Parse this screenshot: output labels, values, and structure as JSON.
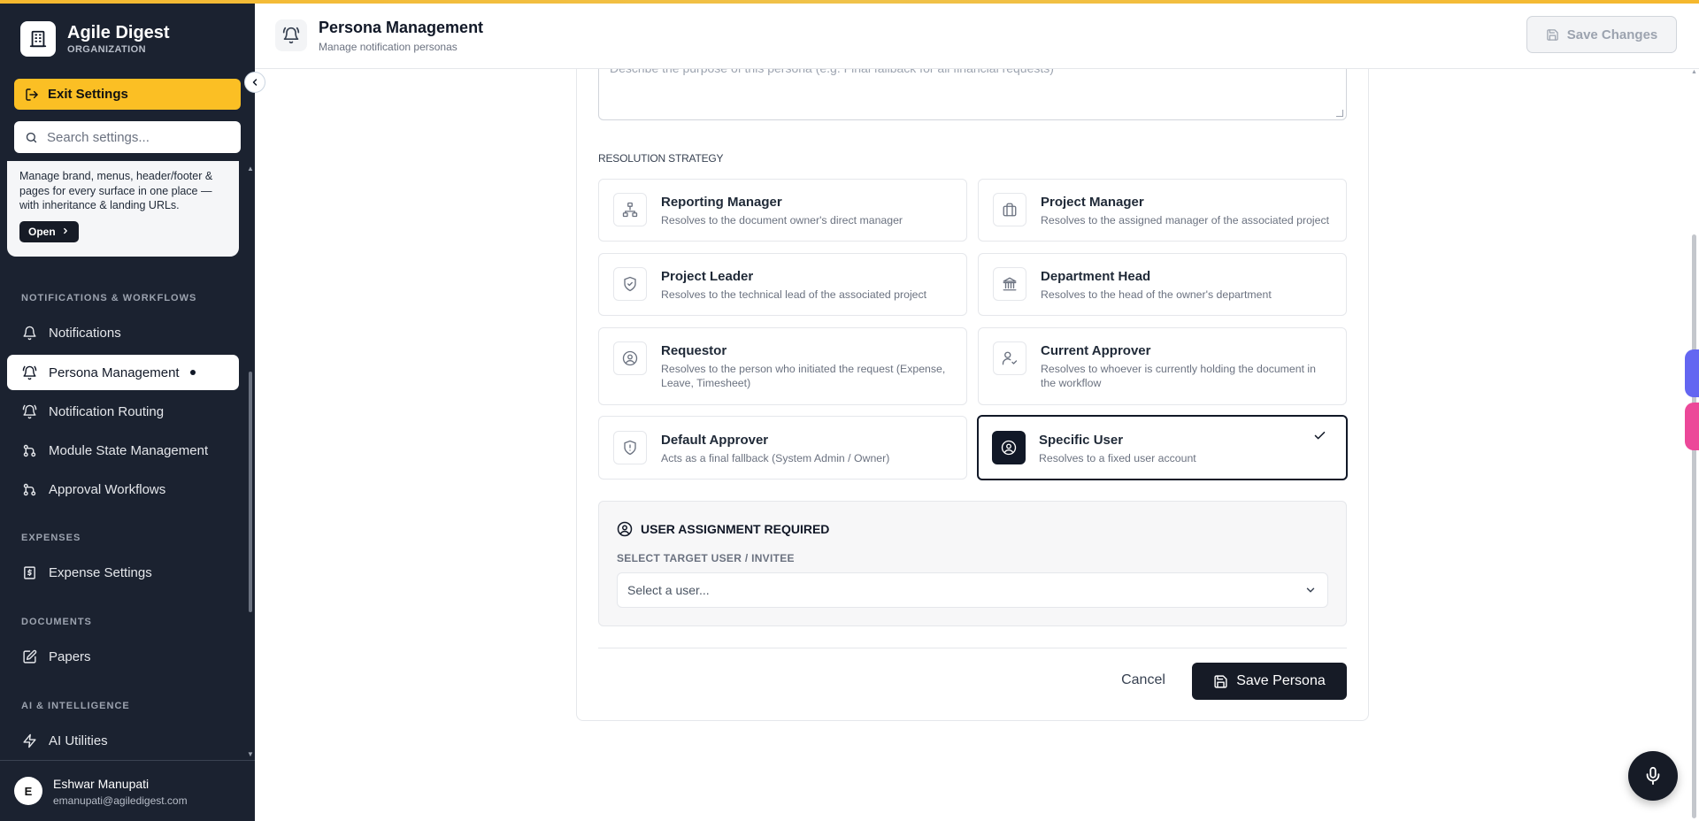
{
  "brand": {
    "name": "Agile Digest",
    "subtitle": "ORGANIZATION"
  },
  "sidebar": {
    "exit_label": "Exit Settings",
    "search_placeholder": "Search settings...",
    "promo": {
      "text": "Manage brand, menus, header/footer & pages for every surface in one place — with inheritance & landing URLs.",
      "button": "Open"
    },
    "sections": [
      {
        "title": "NOTIFICATIONS & WORKFLOWS",
        "items": [
          {
            "label": "Notifications",
            "icon": "bell-icon"
          },
          {
            "label": "Persona Management",
            "icon": "bell-ring-icon",
            "active": true
          },
          {
            "label": "Notification Routing",
            "icon": "bell-ring-icon"
          },
          {
            "label": "Module State Management",
            "icon": "git-branch-icon"
          },
          {
            "label": "Approval Workflows",
            "icon": "git-branch-icon"
          }
        ]
      },
      {
        "title": "EXPENSES",
        "items": [
          {
            "label": "Expense Settings",
            "icon": "receipt-icon"
          }
        ]
      },
      {
        "title": "DOCUMENTS",
        "items": [
          {
            "label": "Papers",
            "icon": "edit-document-icon"
          }
        ]
      },
      {
        "title": "AI & INTELLIGENCE",
        "items": [
          {
            "label": "AI Utilities",
            "icon": "lightning-icon"
          }
        ]
      }
    ],
    "user": {
      "initial": "E",
      "name": "Eshwar Manupati",
      "email": "emanupati@agiledigest.com"
    }
  },
  "header": {
    "title": "Persona Management",
    "subtitle": "Manage notification personas",
    "save_label": "Save Changes"
  },
  "form": {
    "description_placeholder": "Describe the purpose of this persona (e.g. Final fallback for all financial requests)",
    "strategy_label": "RESOLUTION STRATEGY",
    "options": [
      {
        "title": "Reporting Manager",
        "desc": "Resolves to the document owner's direct manager",
        "icon": "org-chart-icon"
      },
      {
        "title": "Project Manager",
        "desc": "Resolves to the assigned manager of the associated project",
        "icon": "briefcase-icon"
      },
      {
        "title": "Project Leader",
        "desc": "Resolves to the technical lead of the associated project",
        "icon": "shield-check-icon"
      },
      {
        "title": "Department Head",
        "desc": "Resolves to the head of the owner's department",
        "icon": "building-icon"
      },
      {
        "title": "Requestor",
        "desc": "Resolves to the person who initiated the request (Expense, Leave, Timesheet)",
        "icon": "user-circle-icon"
      },
      {
        "title": "Current Approver",
        "desc": "Resolves to whoever is currently holding the document in the workflow",
        "icon": "user-check-icon"
      },
      {
        "title": "Default Approver",
        "desc": "Acts as a final fallback (System Admin / Owner)",
        "icon": "shield-alert-icon"
      },
      {
        "title": "Specific User",
        "desc": "Resolves to a fixed user account",
        "icon": "user-circle-icon",
        "selected": true
      }
    ],
    "assignment": {
      "title": "USER ASSIGNMENT REQUIRED",
      "label": "SELECT TARGET USER / INVITEE",
      "select_value": "Select a user..."
    },
    "cancel_label": "Cancel",
    "save_label": "Save Persona"
  },
  "colors": {
    "accent": "#fbbf24",
    "sidebar_bg": "#1b2230",
    "primary_dark": "#161b26"
  }
}
